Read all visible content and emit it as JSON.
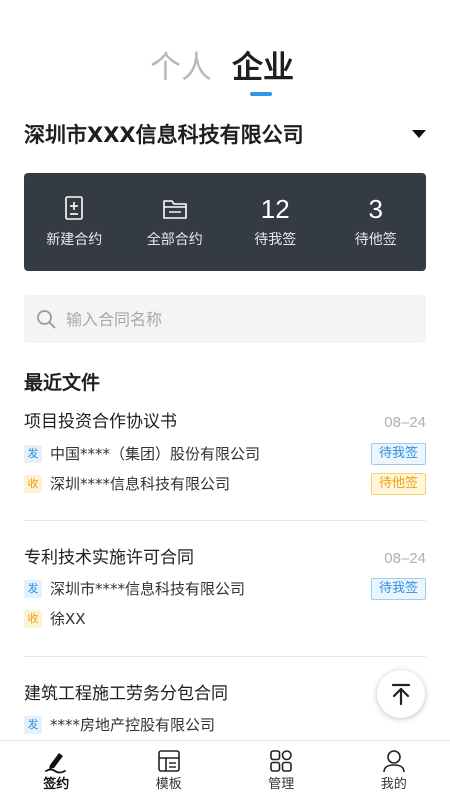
{
  "tabs": {
    "personal": "个人",
    "enterprise": "企业"
  },
  "company": {
    "name": "深圳市XXX信息科技有限公司"
  },
  "stats": [
    {
      "label": "新建合约",
      "icon": "new-contract-icon"
    },
    {
      "label": "全部合约",
      "icon": "folder-icon"
    },
    {
      "number": "12",
      "label": "待我签"
    },
    {
      "number": "3",
      "label": "待他签"
    }
  ],
  "search": {
    "placeholder": "输入合同名称",
    "value": ""
  },
  "recent": {
    "title": "最近文件",
    "docs": [
      {
        "title": "项目投资合作协议书",
        "date": "08–24",
        "parties": [
          {
            "tag": "发",
            "name": "中国****（集团）股份有限公司",
            "status": "待我签"
          },
          {
            "tag": "收",
            "name": "深圳****信息科技有限公司",
            "status": "待他签"
          }
        ]
      },
      {
        "title": "专利技术实施许可合同",
        "date": "08–24",
        "parties": [
          {
            "tag": "发",
            "name": "深圳市****信息科技有限公司",
            "status": "待我签"
          },
          {
            "tag": "收",
            "name": "徐XX"
          }
        ]
      },
      {
        "title": "建筑工程施工劳务分包合同",
        "date": "",
        "parties": [
          {
            "tag": "发",
            "name": "****房地产控股有限公司"
          }
        ]
      }
    ]
  },
  "tabbar": [
    {
      "label": "签约",
      "icon": "sign-pen-icon",
      "active": true
    },
    {
      "label": "模板",
      "icon": "template-icon"
    },
    {
      "label": "管理",
      "icon": "grid-icon"
    },
    {
      "label": "我的",
      "icon": "user-icon"
    }
  ],
  "colors": {
    "accent": "#2f96e8",
    "panel": "#353b42",
    "orange": "#f0a20a"
  }
}
